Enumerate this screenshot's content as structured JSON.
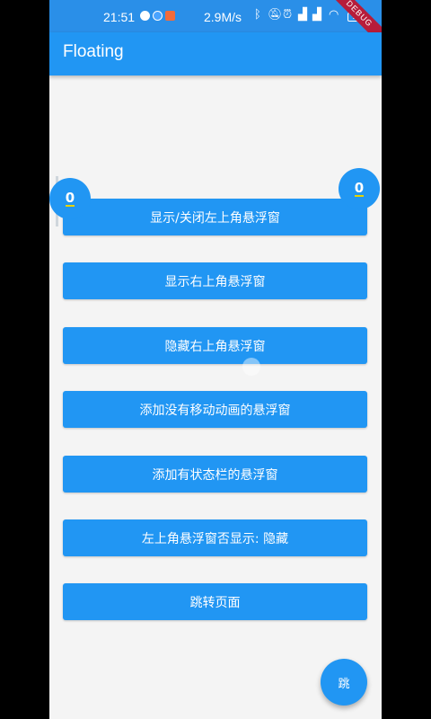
{
  "status_bar": {
    "time": "21:51",
    "network_speed": "2.9M/s",
    "battery": "32",
    "notification_icons": [
      "qq-icon",
      "message-icon",
      "app-notification-icon"
    ],
    "system_icons": [
      "bluetooth-icon",
      "mute-icon",
      "alarm-icon",
      "signal-icon",
      "wifi-icon"
    ]
  },
  "debug_banner": "DEBUG",
  "app_bar": {
    "title": "Floating"
  },
  "floating_windows": {
    "top_left": {
      "count": "0"
    },
    "top_right": {
      "count": "0"
    }
  },
  "buttons": [
    {
      "label": "显示/关闭左上角悬浮窗"
    },
    {
      "label": "显示右上角悬浮窗"
    },
    {
      "label": "隐藏右上角悬浮窗"
    },
    {
      "label": "添加没有移动动画的悬浮窗"
    },
    {
      "label": "添加有状态栏的悬浮窗"
    },
    {
      "label": "左上角悬浮窗否显示: 隐藏"
    },
    {
      "label": "跳转页面"
    }
  ],
  "fab": {
    "label": "跳"
  },
  "colors": {
    "primary": "#2196f3",
    "status_bar": "#2a8fe8",
    "background": "#f4f4f4",
    "debug": "#b71c3a",
    "badge_underline": "#e6d300"
  }
}
